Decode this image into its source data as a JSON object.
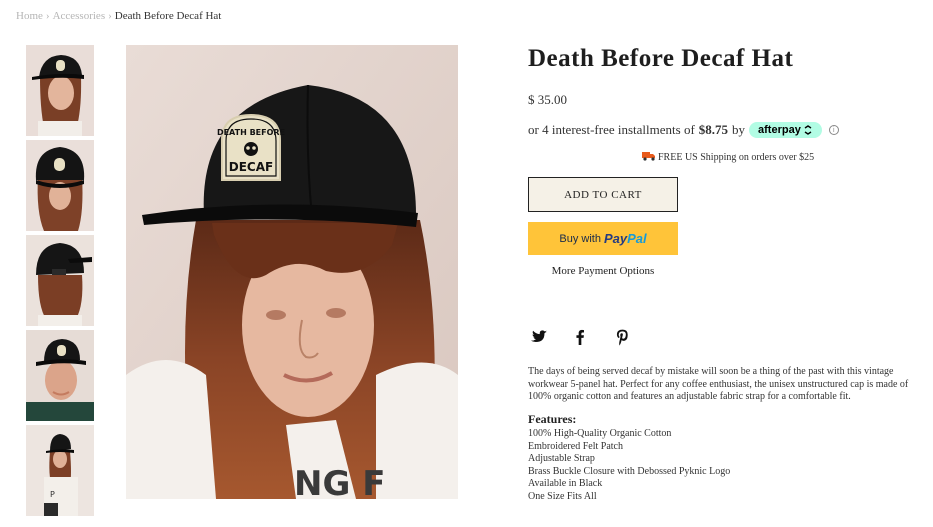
{
  "breadcrumb": {
    "home": "Home",
    "category": "Accessories",
    "current": "Death Before Decaf Hat",
    "separator": "›"
  },
  "product": {
    "title": "Death Before Decaf Hat",
    "price": "$ 35.00",
    "installments_prefix": "or 4 interest-free installments of",
    "installment_amount": "$8.75",
    "installments_suffix": "by",
    "afterpay_label": "afterpay",
    "info_icon": "i",
    "shipping_text": "FREE US Shipping on orders over $25",
    "add_to_cart": "ADD TO CART",
    "paypal_buy": "Buy with",
    "paypal_pay": "Pay",
    "paypal_pal": "Pal",
    "more_payment": "More Payment Options",
    "description": "The days of being served decaf by mistake will soon be a thing of the past with this vintage workwear 5-panel hat. Perfect for any coffee enthusiast, the unisex unstructured cap is made of 100% organic cotton and features an adjustable fabric strap for a comfortable fit.",
    "features_title": "Features:",
    "features": [
      "100% High-Quality Organic Cotton",
      "Embroidered Felt Patch",
      "Adjustable Strap",
      "Brass Buckle Closure with Debossed Pyknic Logo",
      "Available in Black",
      "One Size Fits All"
    ]
  },
  "patch": {
    "line1": "DEATH BEFORE",
    "line2": "DECAF"
  },
  "icons": {
    "truck": "truck-icon",
    "twitter": "twitter-icon",
    "facebook": "facebook-icon",
    "pinterest": "pinterest-icon"
  },
  "colors": {
    "afterpay": "#b2fce4",
    "paypal": "#ffc439",
    "cart_bg": "#f5f1e7"
  }
}
